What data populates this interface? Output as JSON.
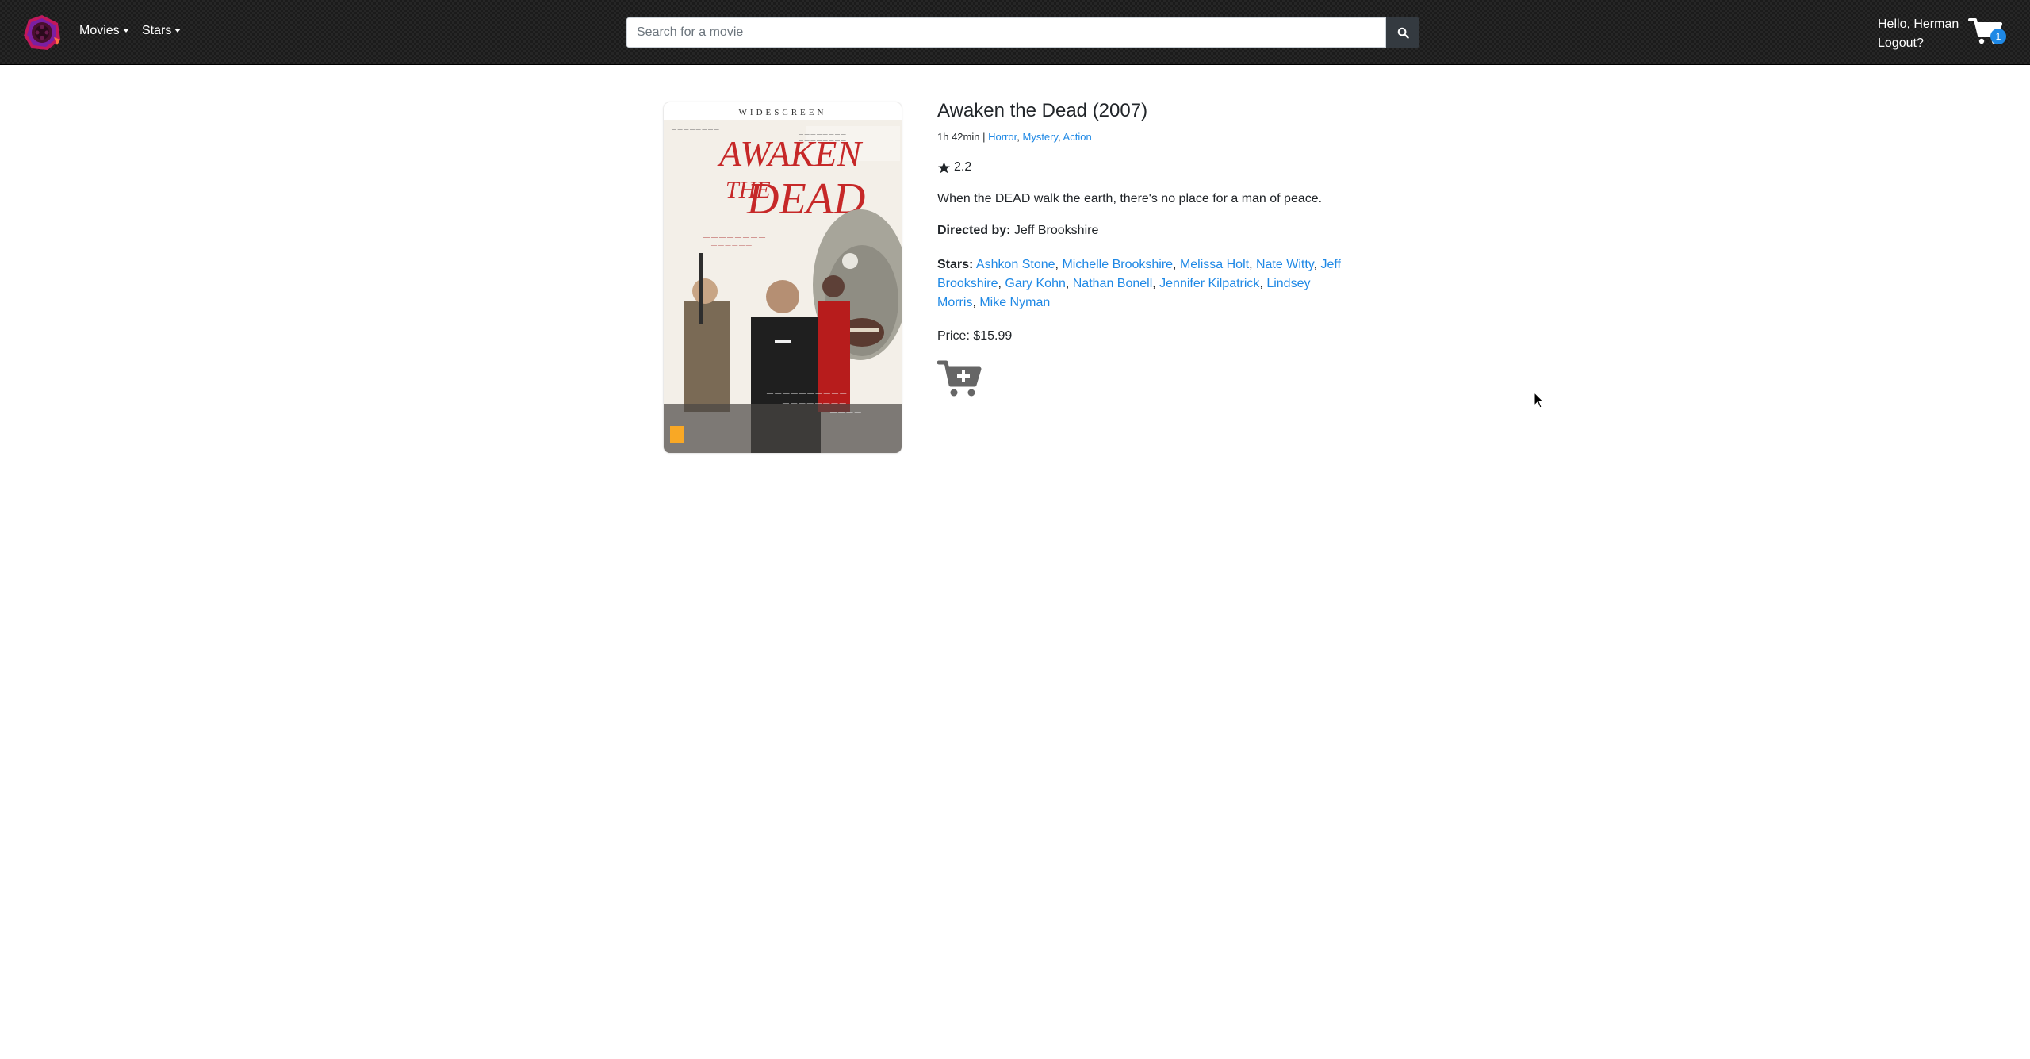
{
  "nav": {
    "menu": [
      {
        "label": "Movies"
      },
      {
        "label": "Stars"
      }
    ],
    "search": {
      "placeholder": "Search for a movie",
      "value": ""
    },
    "greeting": "Hello, Herman",
    "logout": "Logout?",
    "cart_count": "1"
  },
  "movie": {
    "title": "Awaken the Dead (2007)",
    "runtime": "1h 42min",
    "separator": "|",
    "genres": [
      "Horror",
      "Mystery",
      "Action"
    ],
    "rating": "2.2",
    "tagline": "When the DEAD walk the earth, there's no place for a man of peace.",
    "director_label": "Directed by:",
    "director": "Jeff Brookshire",
    "stars_label": "Stars:",
    "stars": [
      "Ashkon Stone",
      "Michelle Brookshire",
      "Melissa Holt",
      "Nate Witty",
      "Jeff Brookshire",
      "Gary Kohn",
      "Nathan Bonell",
      "Jennifer Kilpatrick",
      "Lindsey Morris",
      "Mike Nyman"
    ],
    "price": "Price: $15.99",
    "poster": {
      "top_text": "WIDESCREEN",
      "title_line1": "AWAKEN",
      "title_line2": "THE",
      "title_line3": "DEAD"
    }
  },
  "icons": {
    "logo": "reel-logo-icon",
    "search": "search-icon",
    "cart": "cart-icon",
    "add_to_cart": "cart-plus-icon",
    "star": "star-icon"
  },
  "colors": {
    "link": "#1e88e5",
    "navbar": "#1b1b1b",
    "badge": "#1e88e5"
  }
}
